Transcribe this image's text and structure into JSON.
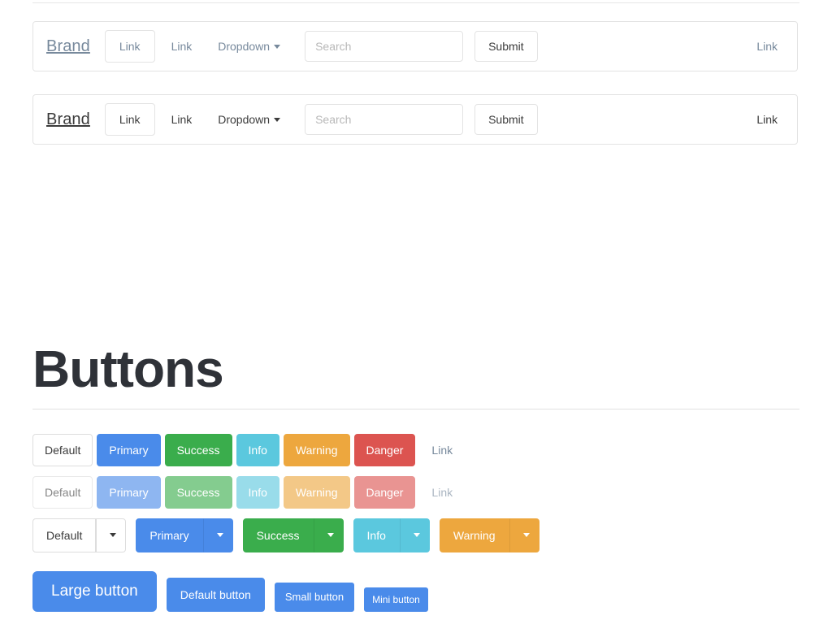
{
  "navbars": [
    {
      "name": "navbar-inverse-light",
      "brand": "Brand",
      "links": [
        {
          "label": "Link",
          "style": "boxed"
        },
        {
          "label": "Link",
          "style": "plain"
        },
        {
          "label": "Dropdown",
          "style": "dropdown",
          "caret": "caret-down-icon"
        }
      ],
      "search": {
        "placeholder": "Search",
        "value": ""
      },
      "submit_label": "Submit",
      "right_link": "Link",
      "text_color": "#77899c"
    },
    {
      "name": "navbar-default",
      "brand": "Brand",
      "links": [
        {
          "label": "Link",
          "style": "boxed"
        },
        {
          "label": "Link",
          "style": "plain"
        },
        {
          "label": "Dropdown",
          "style": "dropdown",
          "caret": "caret-down-icon"
        }
      ],
      "search": {
        "placeholder": "Search",
        "value": ""
      },
      "submit_label": "Submit",
      "right_link": "Link",
      "text_color": "#3b3b3b"
    }
  ],
  "section": {
    "title": "Buttons"
  },
  "button_rows": {
    "basic": [
      {
        "label": "Default",
        "variant": "default"
      },
      {
        "label": "Primary",
        "variant": "primary"
      },
      {
        "label": "Success",
        "variant": "success"
      },
      {
        "label": "Info",
        "variant": "info"
      },
      {
        "label": "Warning",
        "variant": "warning"
      },
      {
        "label": "Danger",
        "variant": "danger"
      },
      {
        "label": "Link",
        "variant": "link"
      }
    ],
    "disabled": [
      {
        "label": "Default",
        "variant": "default"
      },
      {
        "label": "Primary",
        "variant": "primary"
      },
      {
        "label": "Success",
        "variant": "success"
      },
      {
        "label": "Info",
        "variant": "info"
      },
      {
        "label": "Warning",
        "variant": "warning"
      },
      {
        "label": "Danger",
        "variant": "danger"
      },
      {
        "label": "Link",
        "variant": "link"
      }
    ],
    "dropdowns": [
      {
        "label": "Default",
        "variant": "default",
        "toggle_icon": "caret-down-icon"
      },
      {
        "label": "Primary",
        "variant": "primary",
        "toggle_icon": "caret-down-icon"
      },
      {
        "label": "Success",
        "variant": "success",
        "toggle_icon": "caret-down-icon"
      },
      {
        "label": "Info",
        "variant": "info",
        "toggle_icon": "caret-down-icon"
      },
      {
        "label": "Warning",
        "variant": "warning",
        "toggle_icon": "caret-down-icon"
      }
    ],
    "sizes": [
      {
        "label": "Large button",
        "variant": "primary",
        "size": "lg"
      },
      {
        "label": "Default button",
        "variant": "primary",
        "size": "md"
      },
      {
        "label": "Small button",
        "variant": "primary",
        "size": "sm"
      },
      {
        "label": "Mini button",
        "variant": "primary",
        "size": "xs"
      }
    ]
  },
  "colors": {
    "primary": "#4a8bea",
    "success": "#3aad4c",
    "info": "#5bc8de",
    "warning": "#eda73e",
    "danger": "#dc5450",
    "link": "#77899c",
    "default_border": "#dddddd",
    "navbar_border": "#e3e3e3",
    "heading": "#2f3238"
  }
}
